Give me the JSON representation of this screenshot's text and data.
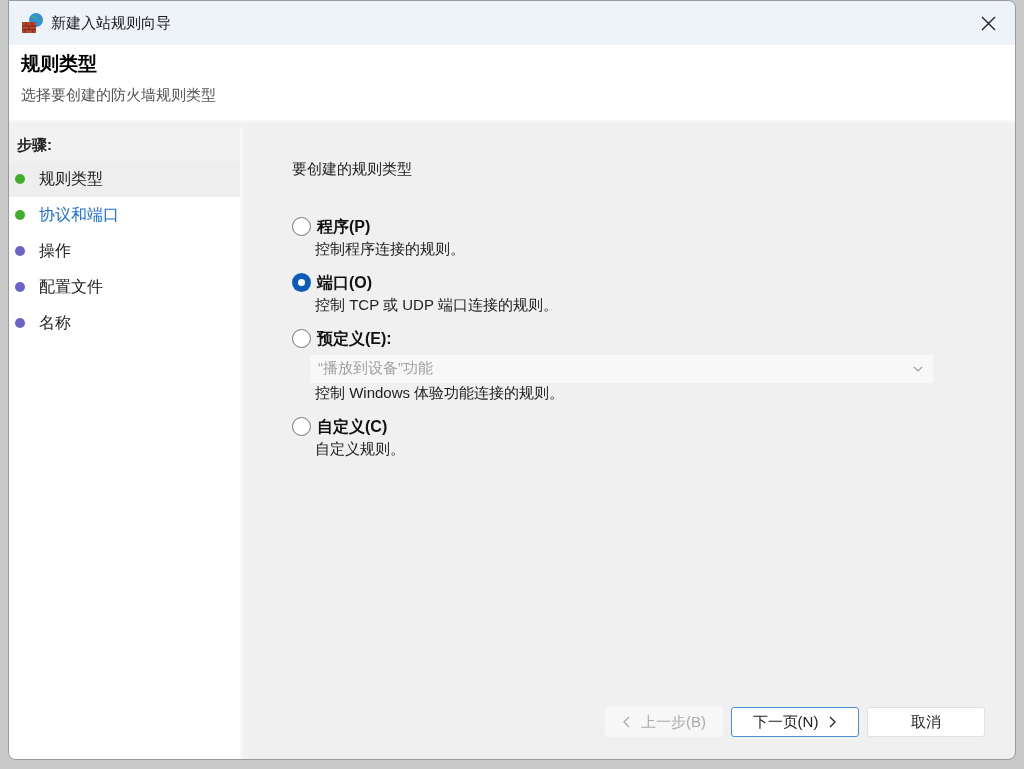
{
  "window": {
    "title": "新建入站规则向导"
  },
  "header": {
    "title": "规则类型",
    "subtitle": "选择要创建的防火墙规则类型"
  },
  "steps_heading": "步骤:",
  "steps": [
    {
      "label": "规则类型",
      "selected": true,
      "hovered": false,
      "color": "#3fae2a"
    },
    {
      "label": "协议和端口",
      "selected": false,
      "hovered": true,
      "color": "#3fae2a"
    },
    {
      "label": "操作",
      "selected": false,
      "hovered": false,
      "color": "#6a63c9"
    },
    {
      "label": "配置文件",
      "selected": false,
      "hovered": false,
      "color": "#6a63c9"
    },
    {
      "label": "名称",
      "selected": false,
      "hovered": false,
      "color": "#6a63c9"
    }
  ],
  "question": "要创建的规则类型",
  "options": [
    {
      "label": "程序(P)",
      "description": "控制程序连接的规则。",
      "selected": false
    },
    {
      "label": "端口(O)",
      "description": "控制 TCP 或 UDP 端口连接的规则。",
      "selected": true
    },
    {
      "label": "预定义(E):",
      "dropdown": {
        "value": "“播放到设备”功能",
        "disabled": true
      },
      "description": "控制 Windows 体验功能连接的规则。",
      "selected": false
    },
    {
      "label": "自定义(C)",
      "description": "自定义规则。",
      "selected": false
    }
  ],
  "buttons": [
    {
      "label": "上一步(B)",
      "kind": "back",
      "disabled": true,
      "focused": false
    },
    {
      "label": "下一页(N)",
      "kind": "next",
      "disabled": false,
      "focused": true
    },
    {
      "label": "取消",
      "kind": "plain",
      "disabled": false,
      "focused": false
    }
  ]
}
